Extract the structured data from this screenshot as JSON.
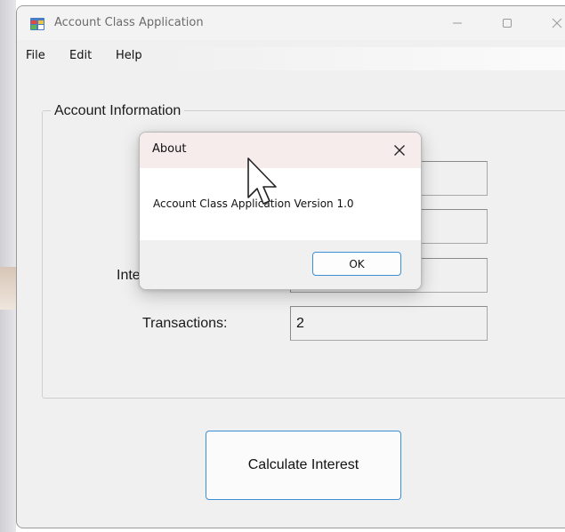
{
  "window": {
    "title": "Account Class Application",
    "caption": {
      "minimize_icon": "minimize-icon",
      "maximize_icon": "maximize-icon",
      "close_icon": "close-icon"
    }
  },
  "menu": {
    "items": [
      {
        "label": "File"
      },
      {
        "label": "Edit"
      },
      {
        "label": "Help"
      }
    ]
  },
  "group": {
    "title": "Account Information",
    "fields": [
      {
        "label": "",
        "value": ""
      },
      {
        "label": "",
        "value": ""
      },
      {
        "label": "Inte",
        "value": ""
      },
      {
        "label": "Transactions:",
        "value": "2"
      }
    ]
  },
  "calculate_button": {
    "label": "Calculate Interest"
  },
  "about_dialog": {
    "title": "About",
    "message": "Account Class Application Version 1.0",
    "ok_label": "OK"
  },
  "colors": {
    "accent": "#3c8fd6",
    "dialog_title_bg": "#f7ecec",
    "window_bg": "#f0f0f0"
  }
}
